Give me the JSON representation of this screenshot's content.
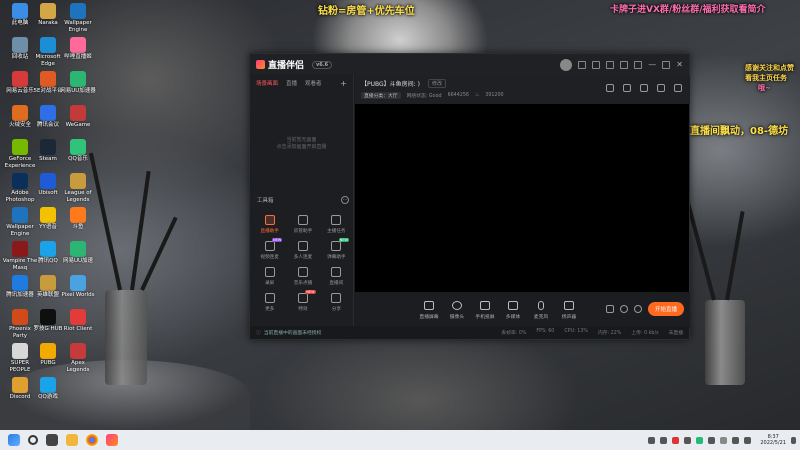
{
  "wallpaper_overlay": {
    "left_banner": "钻粉=房管+优先车位",
    "right_banner": "卡牌子进VX群/粉丝群/福利获取看简介",
    "right_side_1": "感谢关注和点赞",
    "right_side_2": "看我主页任务",
    "right_side_3": "哦~",
    "right_bottom": "直播间飘动，08-德坊"
  },
  "desktop_icons": [
    {
      "label": "此电脑",
      "color": "#3a8ee6"
    },
    {
      "label": "Naraka",
      "color": "#d4a648"
    },
    {
      "label": "Wallpaper Engine",
      "color": "#1e73be"
    },
    {
      "label": "回收站",
      "color": "#6f8ea8"
    },
    {
      "label": "Microsoft Edge",
      "color": "#1a8fd6"
    },
    {
      "label": "哔哩直播姬",
      "color": "#ff6a9a"
    },
    {
      "label": "网易云音乐",
      "color": "#d63a3a"
    },
    {
      "label": "5E对战平台",
      "color": "#e05a24"
    },
    {
      "label": "网易UU加速器",
      "color": "#2bb673"
    },
    {
      "label": "火绒安全",
      "color": "#e06c1f"
    },
    {
      "label": "腾讯会议",
      "color": "#2f6ee6"
    },
    {
      "label": "WeGame",
      "color": "#c23a3a"
    },
    {
      "label": "GeForce Experience",
      "color": "#76b900"
    },
    {
      "label": "Steam",
      "color": "#1b2838"
    },
    {
      "label": "QQ音乐",
      "color": "#31c27c"
    },
    {
      "label": "Adobe Photoshop",
      "color": "#0a2f5a"
    },
    {
      "label": "Ubisoft",
      "color": "#1f5bd6"
    },
    {
      "label": "League of Legends",
      "color": "#c89b3c"
    },
    {
      "label": "Wallpaper Engine",
      "color": "#1e73be"
    },
    {
      "label": "YY语音",
      "color": "#f2c200"
    },
    {
      "label": "斗鱼",
      "color": "#ff7a1a"
    },
    {
      "label": "Vampire The Masq",
      "color": "#8a1a1a"
    },
    {
      "label": "腾讯QQ",
      "color": "#1aa3e8"
    },
    {
      "label": "网易UU加速",
      "color": "#2bb673"
    },
    {
      "label": "腾讯加速器",
      "color": "#1f7be0"
    },
    {
      "label": "英雄联盟",
      "color": "#c89b3c"
    },
    {
      "label": "Pixel Worlds",
      "color": "#4aa3e0"
    },
    {
      "label": "Phoenix Party",
      "color": "#d04a1a"
    },
    {
      "label": "罗技G HUB",
      "color": "#0f0f0f"
    },
    {
      "label": "Riot Client",
      "color": "#e33a3a"
    },
    {
      "label": "SUPER PEOPLE",
      "color": "#d8d8d8"
    },
    {
      "label": "PUBG",
      "color": "#f2a900"
    },
    {
      "label": "Apex Legends",
      "color": "#c53a3a"
    },
    {
      "label": "Discord",
      "color": "#e0a030"
    },
    {
      "label": "QQ游戏",
      "color": "#1aa3e8"
    }
  ],
  "app": {
    "logo_name": "直播伴侣",
    "version": "v6.6",
    "tabs": [
      "场景画面",
      "直播",
      "观看者"
    ],
    "empty_line_1": "当前暂无画面",
    "empty_line_2": "点击添加画面开启直播",
    "tools_title": "工具箱",
    "tools": [
      {
        "label": "直播助手",
        "badge": "",
        "active": true
      },
      {
        "label": "房管助手",
        "badge": "",
        "active": false
      },
      {
        "label": "主播任务",
        "badge": "",
        "active": false
      },
      {
        "label": "视频连麦",
        "badge": "NEW",
        "active": false
      },
      {
        "label": "多人连麦",
        "badge": "",
        "active": false
      },
      {
        "label": "弹幕助手",
        "badge": "NEW",
        "active": false
      },
      {
        "label": "录屏",
        "badge": "",
        "active": false
      },
      {
        "label": "音乐点播",
        "badge": "",
        "active": false
      },
      {
        "label": "直播间",
        "badge": "",
        "active": false
      },
      {
        "label": "更多",
        "badge": "",
        "active": false
      },
      {
        "label": "特效",
        "badge": "NEW",
        "active": false
      },
      {
        "label": "分享",
        "badge": "",
        "active": false
      }
    ],
    "room_title": "【PUBG】斗鱼房间: )",
    "edit_label": "修改",
    "category_tag": "直播分类：大厅",
    "network_label": "网络状态: Good",
    "bitrate": "6644256",
    "fans": "391200",
    "controls": [
      "直播屏幕",
      "摄像头",
      "手机投屏",
      "多媒体",
      "麦克风",
      "扬声器"
    ],
    "start_live_label": "开始直播",
    "status_notice": "当前直播中的画面未经授权",
    "status_stats": [
      "丢帧率: 0%",
      "FPS: 60",
      "CPU: 13%",
      "内存: 22%",
      "上传: 0 kb/s",
      "未直播"
    ]
  },
  "taskbar": {
    "time": "8:37",
    "date": "2022/5/21"
  }
}
